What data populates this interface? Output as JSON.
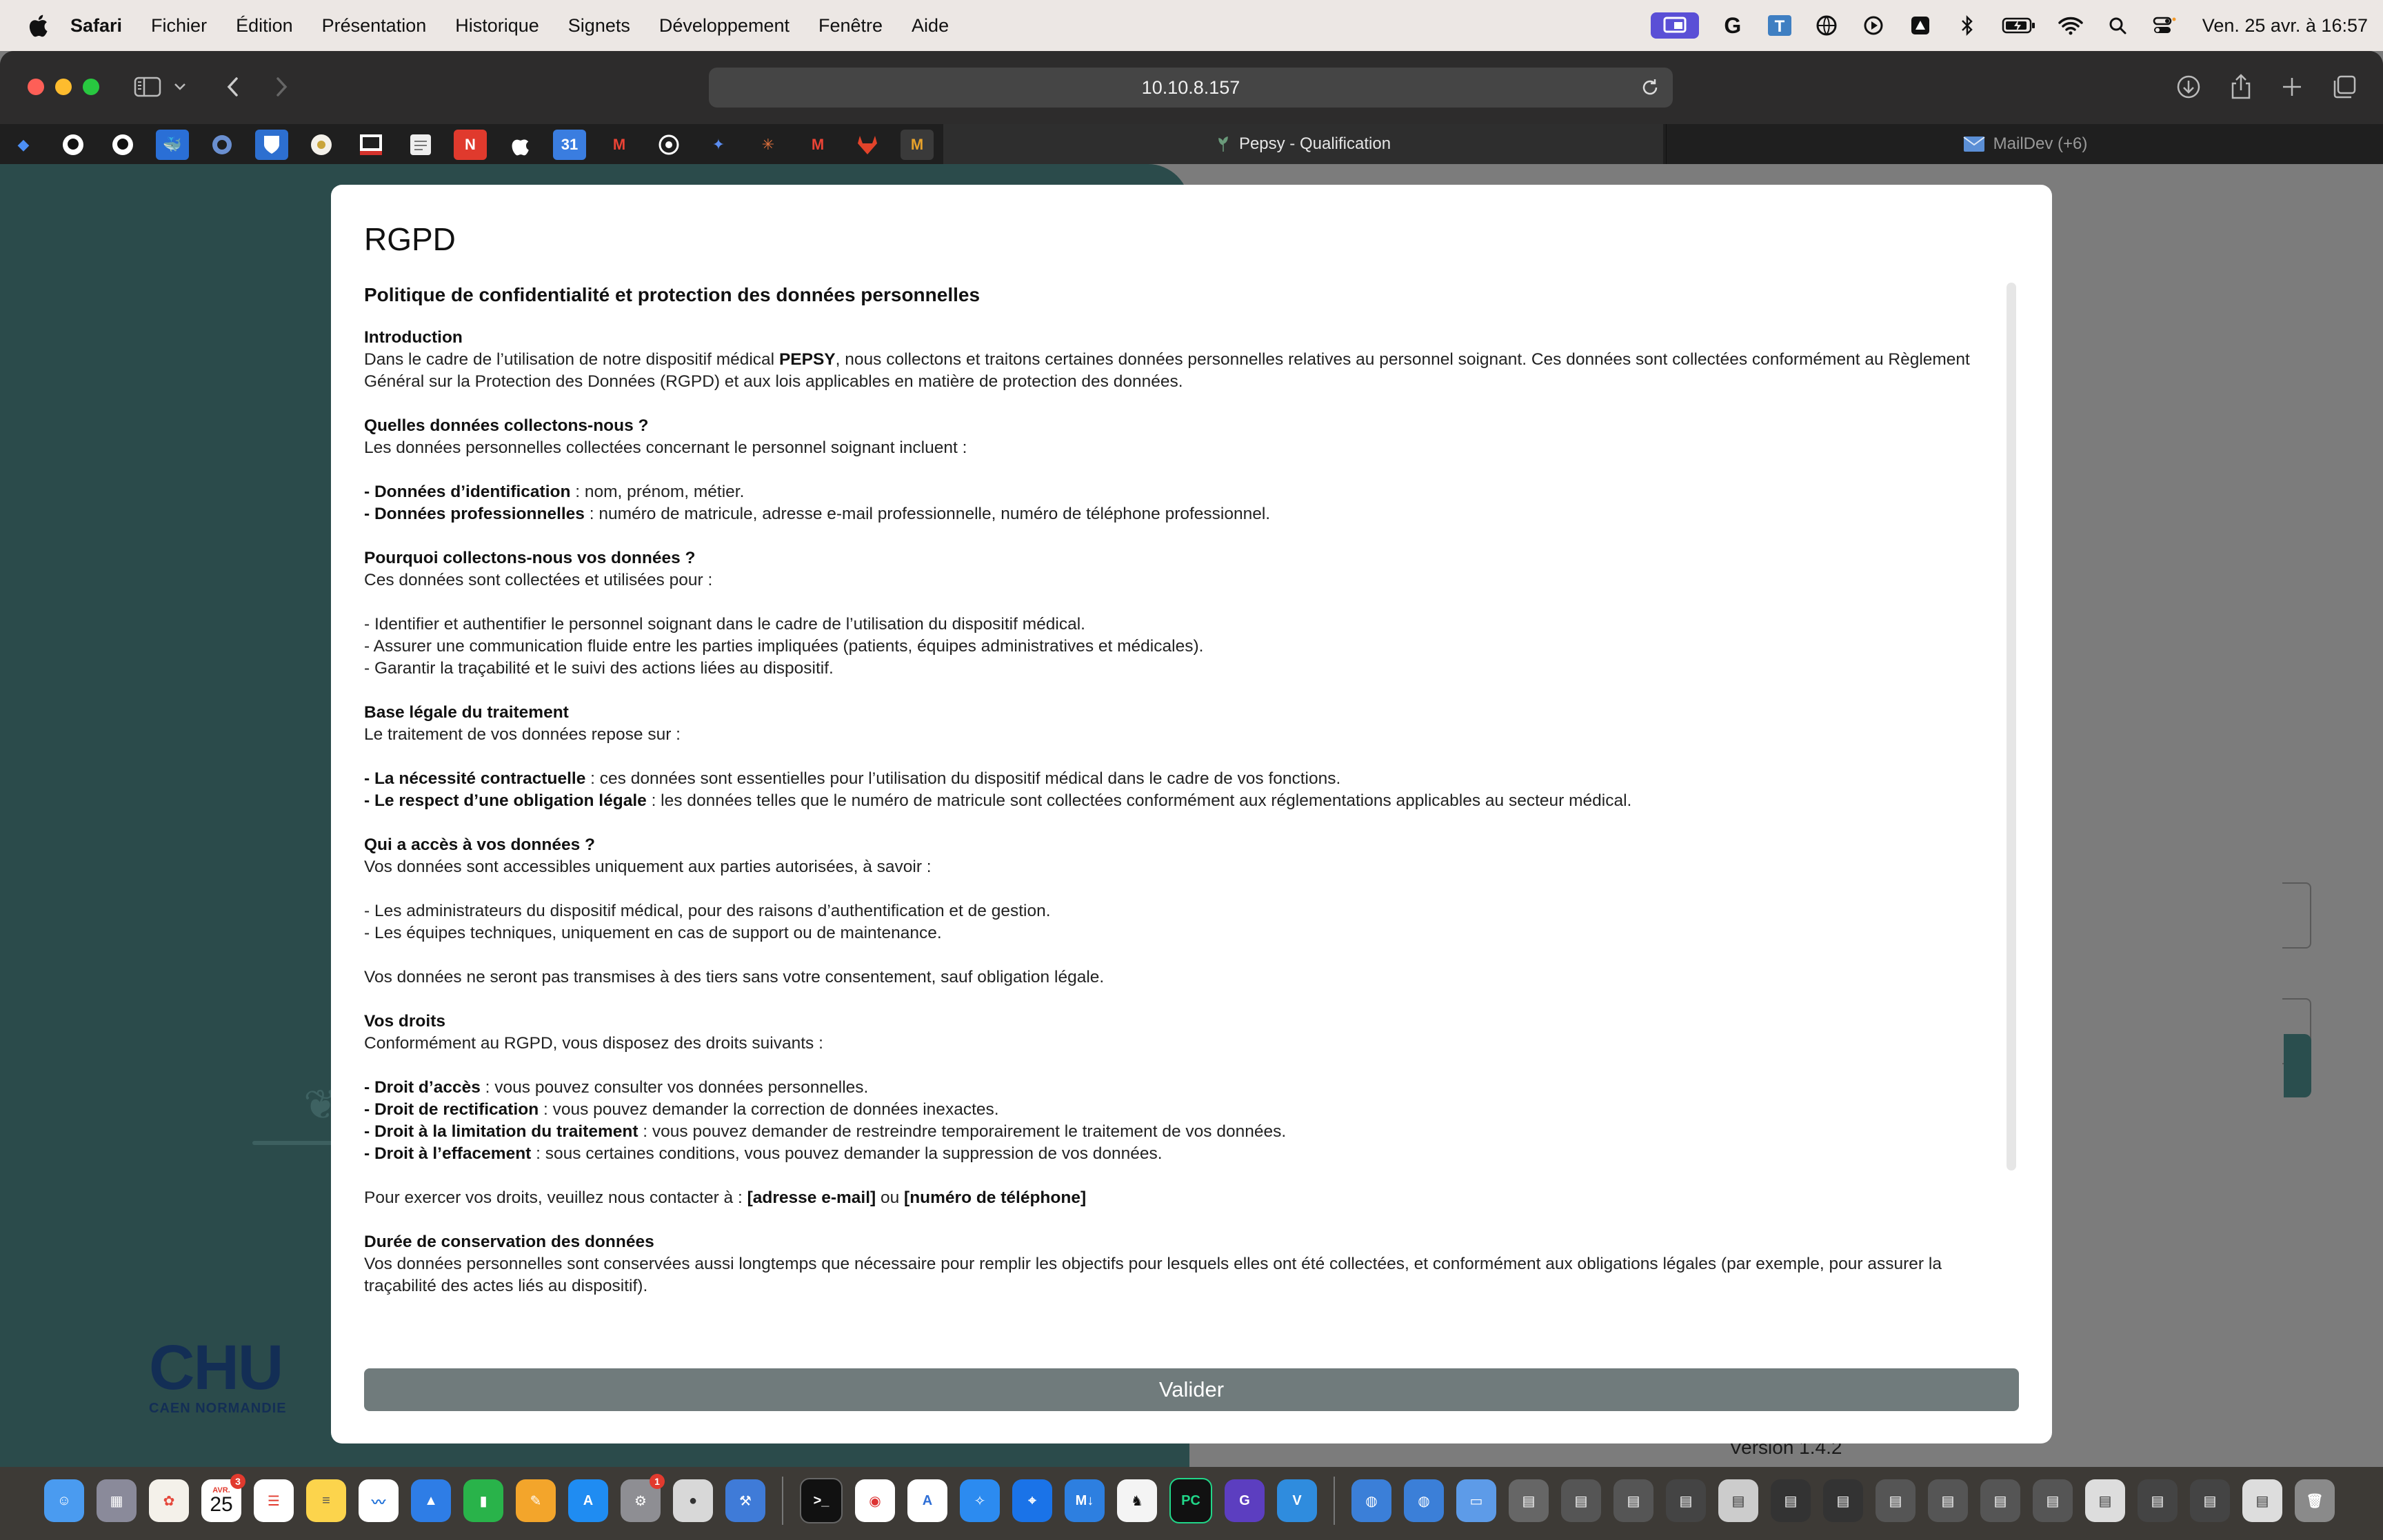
{
  "menubar": {
    "app": "Safari",
    "items": [
      "Fichier",
      "Édition",
      "Présentation",
      "Historique",
      "Signets",
      "Développement",
      "Fenêtre",
      "Aide"
    ],
    "clock": "Ven. 25 avr. à 16:57"
  },
  "browser": {
    "url": "10.10.8.157",
    "tabs": [
      {
        "title": "Pepsy - Qualification"
      },
      {
        "title": "MailDev (+6)"
      }
    ]
  },
  "page": {
    "logo": {
      "big": "CHU",
      "small": "CAEN NORMANDIE"
    },
    "version": "Version 1.4.2"
  },
  "modal": {
    "title": "RGPD",
    "subtitle": "Politique de confidentialité et protection des données personnelles",
    "intro_heading": "Introduction",
    "intro_pre": "Dans le cadre de l’utilisation de notre dispositif médical ",
    "intro_bold": "PEPSY",
    "intro_post": ", nous collectons et traitons certaines données personnelles relatives au personnel soignant. Ces données sont collectées conformément au Règlement Général sur la Protection des Données (RGPD) et aux lois applicables en matière de protection des données.",
    "q1_heading": "Quelles données collectons-nous ?",
    "q1_text": "Les données personnelles collectées concernant le personnel soignant incluent :",
    "q1_b1_label": "- Données d’identification",
    "q1_b1_text": " : nom, prénom, métier.",
    "q1_b2_label": "- Données professionnelles",
    "q1_b2_text": " : numéro de matricule, adresse e-mail professionnelle, numéro de téléphone professionnel.",
    "q2_heading": "Pourquoi collectons-nous vos données ?",
    "q2_text": "Ces données sont collectées et utilisées pour :",
    "q2_items": [
      "- Identifier et authentifier le personnel soignant dans le cadre de l’utilisation du dispositif médical.",
      "- Assurer une communication fluide entre les parties impliquées (patients, équipes administratives et médicales).",
      "- Garantir la traçabilité et le suivi des actions liées au dispositif."
    ],
    "base_heading": "Base légale du traitement",
    "base_text": "Le traitement de vos données repose sur :",
    "base_b1_label": "- La nécessité contractuelle",
    "base_b1_text": " : ces données sont essentielles pour l’utilisation du dispositif médical dans le cadre de vos fonctions.",
    "base_b2_label": "- Le respect d’une obligation légale",
    "base_b2_text": " : les données telles que le numéro de matricule sont collectées conformément aux réglementations applicables au secteur médical.",
    "access_heading": "Qui a accès à vos données ?",
    "access_text": "Vos données sont accessibles uniquement aux parties autorisées, à savoir :",
    "access_items": [
      "- Les administrateurs du dispositif médical, pour des raisons d’authentification et de gestion.",
      "- Les équipes techniques, uniquement en cas de support ou de maintenance."
    ],
    "access_note": "Vos données ne seront pas transmises à des tiers sans votre consentement, sauf obligation légale.",
    "rights_heading": "Vos droits",
    "rights_text": "Conformément au RGPD, vous disposez des droits suivants :",
    "rights_b1_label": "- Droit d’accès",
    "rights_b1_text": " : vous pouvez consulter vos données personnelles.",
    "rights_b2_label": "- Droit de rectification",
    "rights_b2_text": " : vous pouvez demander la correction de données inexactes.",
    "rights_b3_label": "- Droit à la limitation du traitement",
    "rights_b3_text": " : vous pouvez demander de restreindre temporairement le traitement de vos données.",
    "rights_b4_label": "- Droit à l’effacement",
    "rights_b4_text": " : sous certaines conditions, vous pouvez demander la suppression de vos données.",
    "contact_pre": "Pour exercer vos droits, veuillez nous contacter à : ",
    "contact_email": "[adresse e-mail]",
    "contact_mid": " ou ",
    "contact_phone": "[numéro de téléphone]",
    "retention_heading": "Durée de conservation des données",
    "retention_text": "Vos données personnelles sont conservées aussi longtemps que nécessaire pour remplir les objectifs pour lesquels elles ont été collectées, et conformément aux obligations légales (par exemple, pour assurer la traçabilité des actes liés au dispositif).",
    "button": "Valider"
  },
  "dock": {
    "calendar_day": "25",
    "calendar_month": "AVR.",
    "mail_badge": "3",
    "settings_badge": "1"
  }
}
